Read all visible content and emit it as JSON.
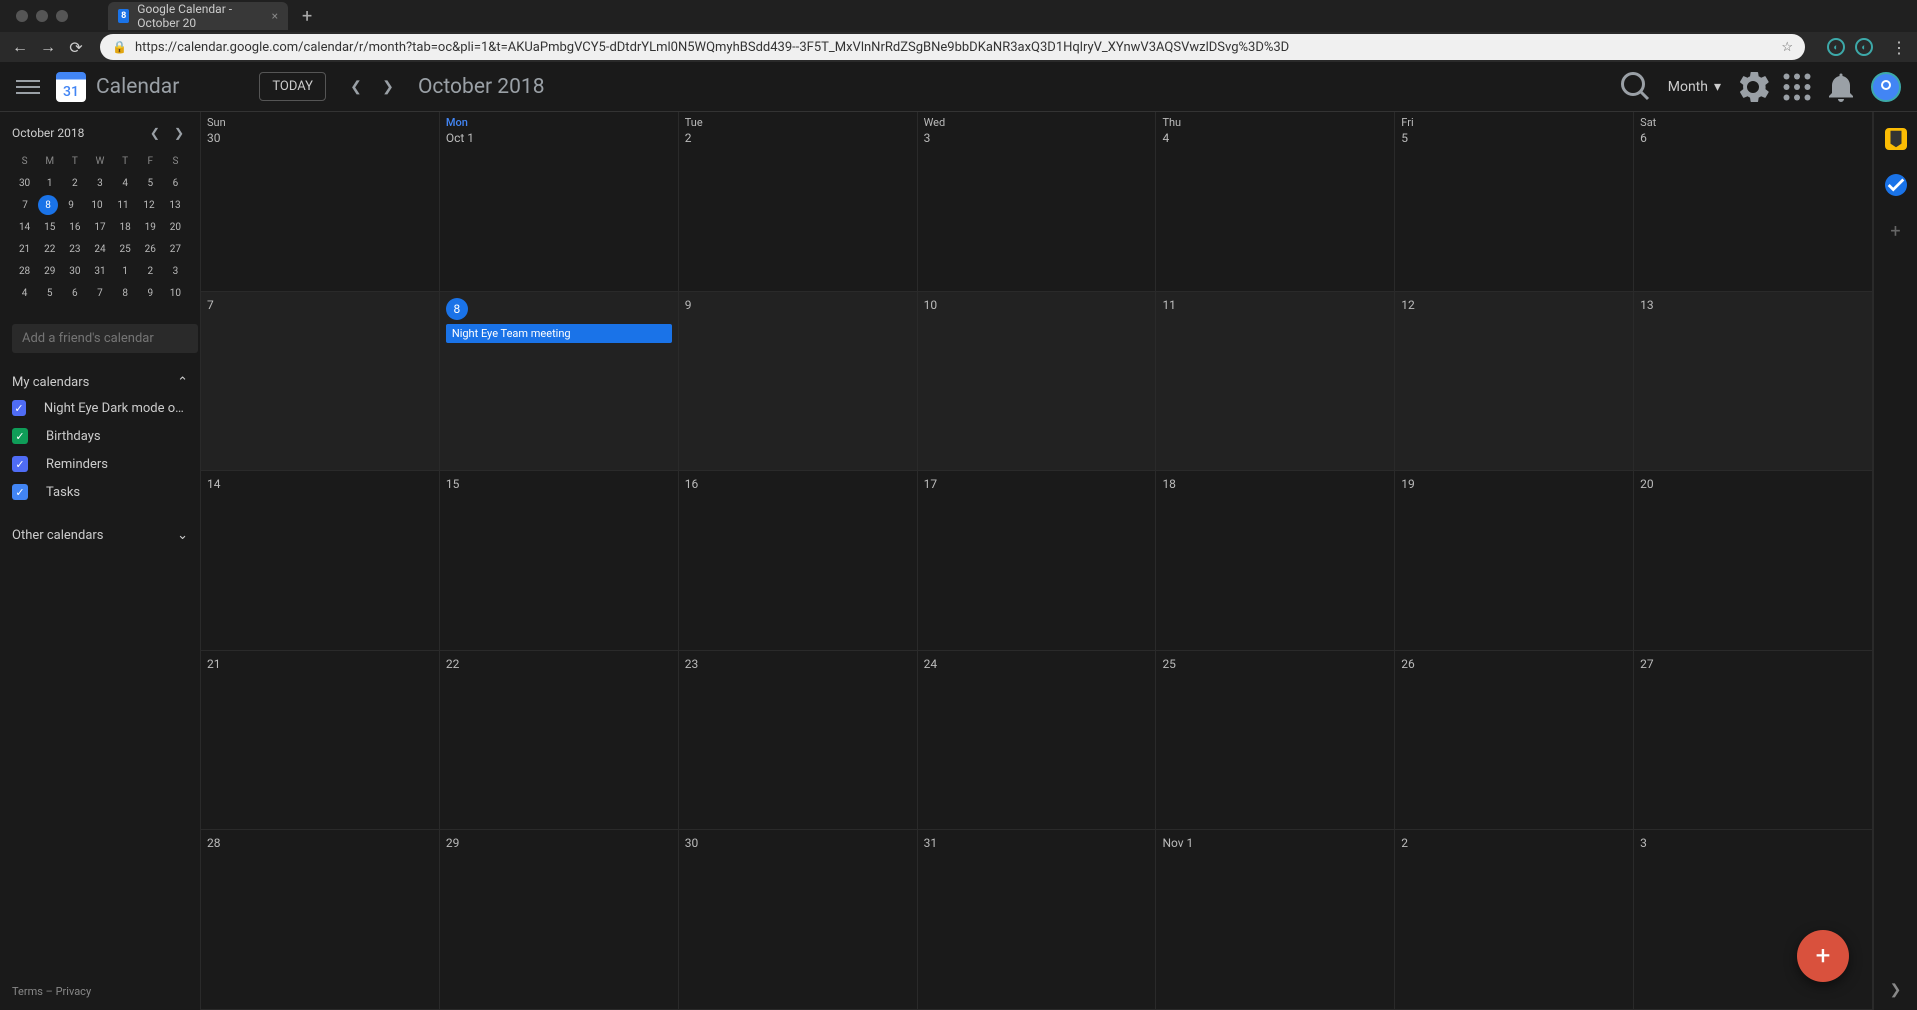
{
  "browser": {
    "tab_title": "Google Calendar - October 20",
    "tab_favicon": "8",
    "url": "https://calendar.google.com/calendar/r/month?tab=oc&pli=1&t=AKUaPmbgVCY5-dDtdrYLml0N5WQmyhBSdd439--3F5T_MxVlnNrRdZSgBNe9bbDKaNR3axQ3D1HqlryV_XYnwV3AQSVwzlDSvg%3D%3D"
  },
  "header": {
    "app_title": "Calendar",
    "logo_day": "31",
    "today_label": "TODAY",
    "period": "October 2018",
    "view_label": "Month"
  },
  "mini_calendar": {
    "title": "October 2018",
    "dow": [
      "S",
      "M",
      "T",
      "W",
      "T",
      "F",
      "S"
    ],
    "weeks": [
      [
        "30",
        "1",
        "2",
        "3",
        "4",
        "5",
        "6"
      ],
      [
        "7",
        "8",
        "9",
        "10",
        "11",
        "12",
        "13"
      ],
      [
        "14",
        "15",
        "16",
        "17",
        "18",
        "19",
        "20"
      ],
      [
        "21",
        "22",
        "23",
        "24",
        "25",
        "26",
        "27"
      ],
      [
        "28",
        "29",
        "30",
        "31",
        "1",
        "2",
        "3"
      ],
      [
        "4",
        "5",
        "6",
        "7",
        "8",
        "9",
        "10"
      ]
    ],
    "today": "8"
  },
  "sidebar": {
    "add_friend_placeholder": "Add a friend's calendar",
    "my_calendars_label": "My calendars",
    "other_calendars_label": "Other calendars",
    "calendars": [
      {
        "label": "Night Eye Dark mode on an...",
        "color": "#4f6cf5",
        "checked": true
      },
      {
        "label": "Birthdays",
        "color": "#0f9d58",
        "checked": true
      },
      {
        "label": "Reminders",
        "color": "#4f6cf5",
        "checked": true
      },
      {
        "label": "Tasks",
        "color": "#4285f4",
        "checked": true
      }
    ],
    "terms": "Terms",
    "privacy": "Privacy"
  },
  "grid": {
    "dow": [
      "Sun",
      "Mon",
      "Tue",
      "Wed",
      "Thu",
      "Fri",
      "Sat"
    ],
    "today_col": 1,
    "today_row": 1,
    "weeks": [
      [
        "30",
        "Oct 1",
        "2",
        "3",
        "4",
        "5",
        "6"
      ],
      [
        "7",
        "8",
        "9",
        "10",
        "11",
        "12",
        "13"
      ],
      [
        "14",
        "15",
        "16",
        "17",
        "18",
        "19",
        "20"
      ],
      [
        "21",
        "22",
        "23",
        "24",
        "25",
        "26",
        "27"
      ],
      [
        "28",
        "29",
        "30",
        "31",
        "Nov 1",
        "2",
        "3"
      ]
    ],
    "events": [
      {
        "row": 1,
        "col": 1,
        "title": "Night Eye Team meeting"
      }
    ]
  }
}
